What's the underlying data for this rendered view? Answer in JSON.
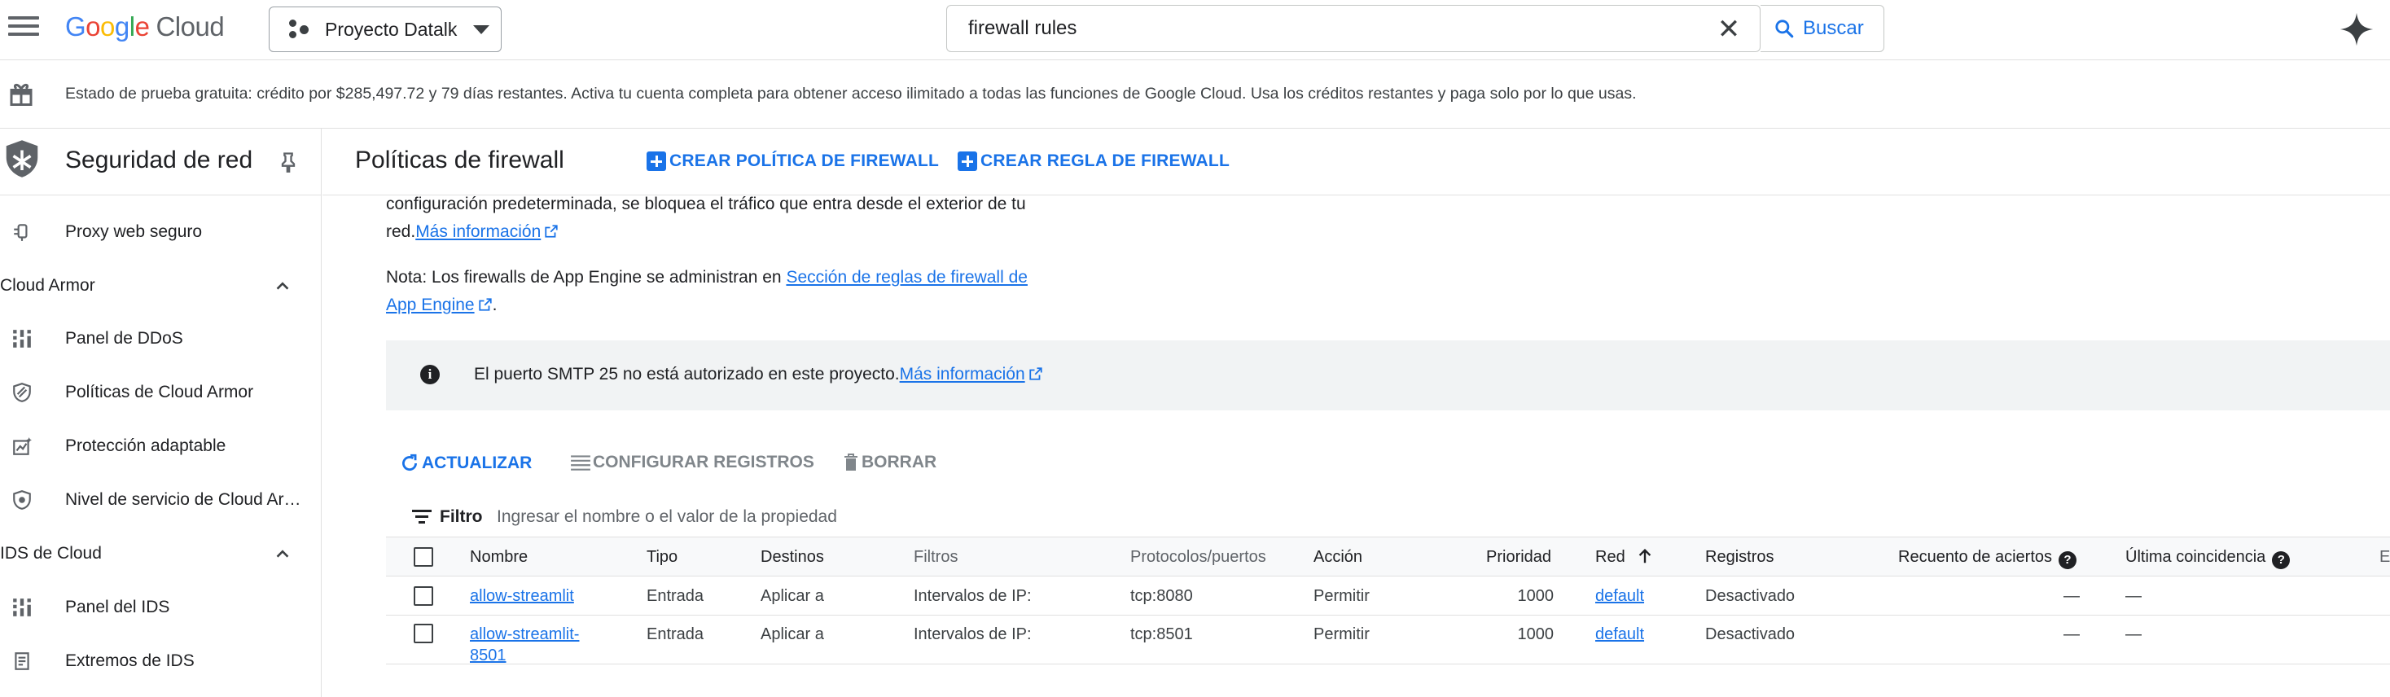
{
  "topbar": {
    "logo_google": "Google",
    "logo_cloud": "Cloud",
    "project": "Proyecto Datalk",
    "search_value": "firewall rules",
    "search_button": "Buscar"
  },
  "trial": {
    "text": "Estado de prueba gratuita: crédito por $285,497.72 y 79 días restantes. Activa tu cuenta completa para obtener acceso ilimitado a todas las funciones de Google Cloud. Usa los créditos restantes y paga solo por lo que usas."
  },
  "sidebar": {
    "title": "Seguridad de red",
    "items": [
      {
        "label": "Proxy web seguro",
        "icon": "proxy-icon"
      },
      {
        "label": "Panel de DDoS",
        "icon": "dashboard-icon"
      },
      {
        "label": "Políticas de Cloud Armor",
        "icon": "shield-icon"
      },
      {
        "label": "Protección adaptable",
        "icon": "adaptive-icon"
      },
      {
        "label": "Nivel de servicio de Cloud Armor",
        "icon": "service-tier-icon"
      },
      {
        "label": "Panel del IDS",
        "icon": "dashboard-icon"
      },
      {
        "label": "Extremos de IDS",
        "icon": "endpoint-icon"
      }
    ],
    "sections": [
      {
        "label": "Cloud Armor"
      },
      {
        "label": "IDS de Cloud"
      }
    ]
  },
  "main": {
    "title": "Políticas de firewall",
    "create_policy": "CREAR POLÍTICA DE FIREWALL",
    "create_rule": "CREAR REGLA DE FIREWALL",
    "para1_line1": "configuración predeterminada, se bloquea el tráfico que entra desde el exterior de tu",
    "para1_line2_prefix": "red.",
    "para1_link": "Más información",
    "para2_line1_prefix": "Nota: Los firewalls de App Engine se administran en ",
    "para2_link_line1": "Sección de reglas de firewall de",
    "para2_link_line2": "App Engine",
    "para2_suffix": ".",
    "notice_text": "El puerto SMTP 25 no está autorizado en este proyecto.",
    "notice_link": "Más información",
    "toolbar": {
      "refresh": "ACTUALIZAR",
      "configure_logs": "CONFIGURAR REGISTROS",
      "delete": "BORRAR"
    },
    "filter": {
      "label": "Filtro",
      "placeholder": "Ingresar el nombre o el valor de la propiedad"
    },
    "table": {
      "headers": {
        "name": "Nombre",
        "type": "Tipo",
        "targets": "Destinos",
        "filters": "Filtros",
        "protocols": "Protocolos/puertos",
        "action": "Acción",
        "priority": "Prioridad",
        "network": "Red",
        "logs": "Registros",
        "hit_count": "Recuento de aciertos",
        "last_hit": "Última coincidencia",
        "extra": "E"
      },
      "rows": [
        {
          "name": "allow-streamlit",
          "name_line2": "",
          "type": "Entrada",
          "targets": "Aplicar a",
          "filters": "Intervalos de IP:",
          "protocols": "tcp:8080",
          "action": "Permitir",
          "priority": "1000",
          "network": "default",
          "logs": "Desactivado",
          "hit_count": "—",
          "last_hit": "—"
        },
        {
          "name": "allow-streamlit-",
          "name_line2": "8501",
          "type": "Entrada",
          "targets": "Aplicar a",
          "filters": "Intervalos de IP:",
          "protocols": "tcp:8501",
          "action": "Permitir",
          "priority": "1000",
          "network": "default",
          "logs": "Desactivado",
          "hit_count": "—",
          "last_hit": "—"
        }
      ]
    }
  },
  "colors": {
    "accent": "#1a73e8",
    "notice_bg": "#f1f3f4",
    "text": "#202124"
  }
}
